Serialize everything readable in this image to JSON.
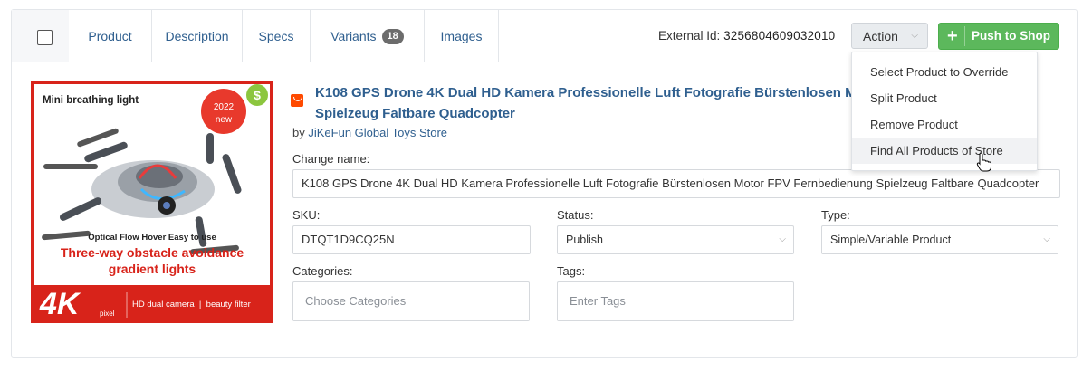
{
  "tabs": {
    "product": "Product",
    "description": "Description",
    "specs": "Specs",
    "variants": "Variants",
    "variants_count": "18",
    "images": "Images"
  },
  "header": {
    "external_id_label": "External Id:",
    "external_id_value": "3256804609032010",
    "action_label": "Action",
    "push_label": "Push to Shop"
  },
  "action_menu": {
    "items": [
      "Select Product to Override",
      "Split Product",
      "Remove Product",
      "Find All Products of Store"
    ]
  },
  "product": {
    "title_line1": "K108 GPS Drone 4K Dual HD Kamera Professionelle Luft Fotografie Bürstenlosen Motor FPV Fernbedienung",
    "title_line2": "Spielzeug Faltbare Quadcopter",
    "by_label": "by",
    "store_name": "JiKeFun Global Toys Store"
  },
  "image": {
    "mini_light": "Mini breathing light",
    "badge_year": "2022",
    "badge_new": "new",
    "optical": "Optical Flow Hover Easy to use",
    "headline1": "Three-way obstacle avoidance",
    "headline2": "gradient lights",
    "res": "4K",
    "res_sub": "pixel",
    "features": "HD dual camera  |  beauty filter"
  },
  "form": {
    "change_name_label": "Change name:",
    "change_name_value": "K108 GPS Drone 4K Dual HD Kamera Professionelle Luft Fotografie Bürstenlosen Motor FPV Fernbedienung Spielzeug Faltbare Quadcopter",
    "sku_label": "SKU:",
    "sku_value": "DTQT1D9CQ25N",
    "status_label": "Status:",
    "status_value": "Publish",
    "type_label": "Type:",
    "type_value": "Simple/Variable Product",
    "categories_label": "Categories:",
    "categories_placeholder": "Choose Categories",
    "tags_label": "Tags:",
    "tags_placeholder": "Enter Tags"
  },
  "colors": {
    "link": "#2f5f8f",
    "push_green": "#5cb85c",
    "badge_red": "#e8392c",
    "banner_red": "#d8231a"
  }
}
